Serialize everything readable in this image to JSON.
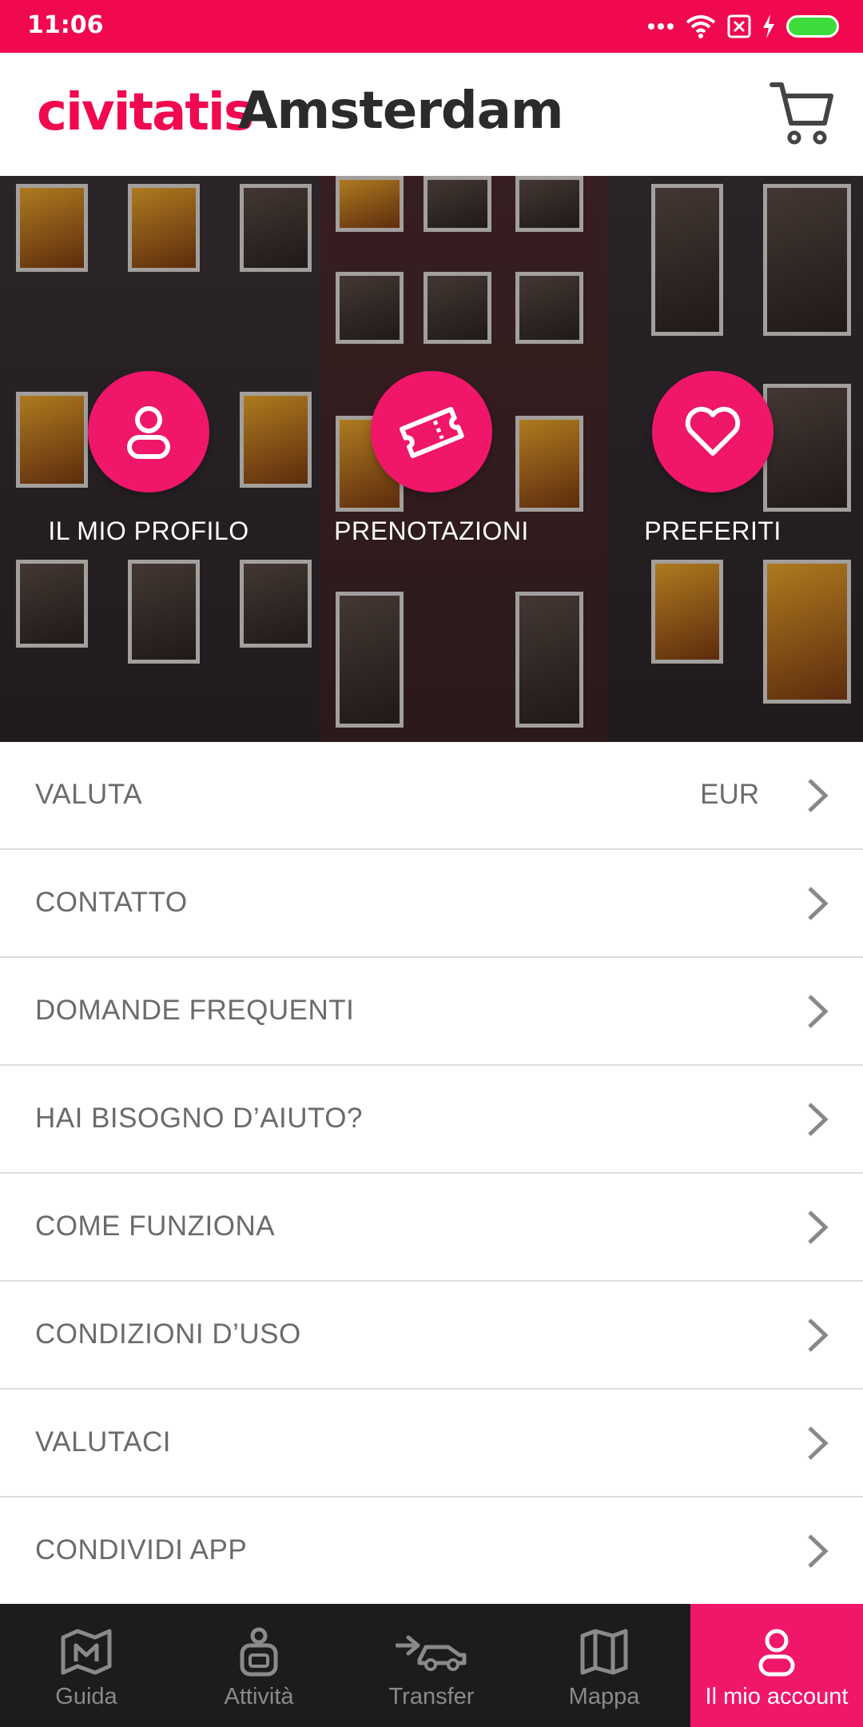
{
  "status_bar": {
    "time": "11:06"
  },
  "header": {
    "logo": "civitatis",
    "city": "Amsterdam"
  },
  "quick_actions": [
    {
      "label": "IL MIO PROFILO",
      "icon": "user-icon"
    },
    {
      "label": "PRENOTAZIONI",
      "icon": "ticket-icon"
    },
    {
      "label": "PREFERITI",
      "icon": "heart-icon"
    }
  ],
  "menu": [
    {
      "label": "VALUTA",
      "value": "EUR"
    },
    {
      "label": "CONTATTO"
    },
    {
      "label": "DOMANDE FREQUENTI"
    },
    {
      "label": "HAI BISOGNO D’AIUTO?"
    },
    {
      "label": "COME FUNZIONA"
    },
    {
      "label": "CONDIZIONI D’USO"
    },
    {
      "label": "VALUTACI"
    },
    {
      "label": "CONDIVIDI APP"
    }
  ],
  "bottom_nav": [
    {
      "label": "Guida",
      "icon": "guide-map-icon"
    },
    {
      "label": "Attività",
      "icon": "activities-icon"
    },
    {
      "label": "Transfer",
      "icon": "transfer-car-icon"
    },
    {
      "label": "Mappa",
      "icon": "map-icon"
    },
    {
      "label": "Il mio account",
      "icon": "account-icon",
      "active": true
    }
  ],
  "colors": {
    "brand": "#f0094f",
    "accent": "#f0166a",
    "nav_bg": "#1c1b1e"
  }
}
